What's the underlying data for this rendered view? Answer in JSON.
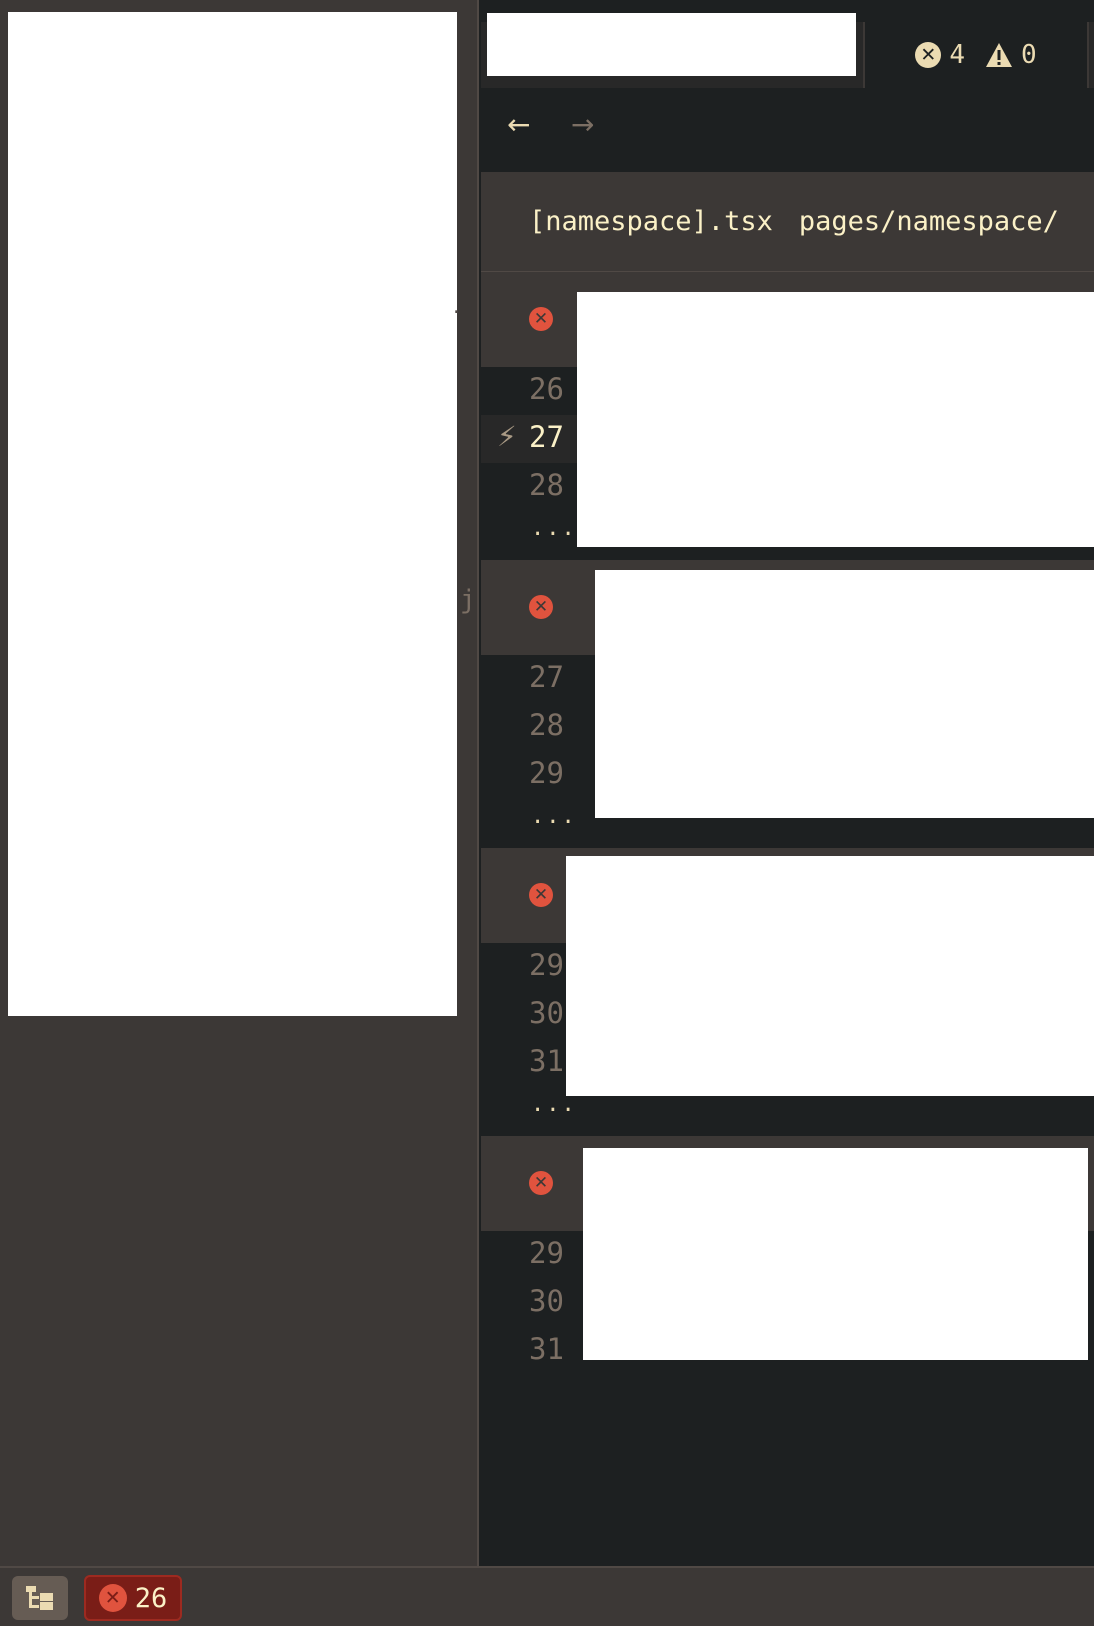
{
  "diagnostics_tab": {
    "error_count": "4",
    "warning_count": "0"
  },
  "nav": {
    "back_icon": "arrow-left-icon",
    "forward_icon": "arrow-right-icon",
    "back": "←",
    "forward": "→"
  },
  "file": {
    "name": "[namespace].tsx",
    "path": "pages/namespace/"
  },
  "peek": {
    "left_j": "j"
  },
  "groups": [
    {
      "lines": [
        "26",
        "27",
        "28"
      ],
      "current_line": "27",
      "ellipsis": "..."
    },
    {
      "lines": [
        "27",
        "28",
        "29"
      ],
      "ellipsis": "..."
    },
    {
      "lines": [
        "29",
        "30",
        "31"
      ],
      "ellipsis": "..."
    },
    {
      "lines": [
        "29",
        "30",
        "31"
      ]
    }
  ],
  "statusbar": {
    "error_count": "26"
  },
  "colors": {
    "error": "#e0533e",
    "panel": "#3c3836",
    "editor": "#1d2021",
    "text": "#ebdbb2"
  }
}
